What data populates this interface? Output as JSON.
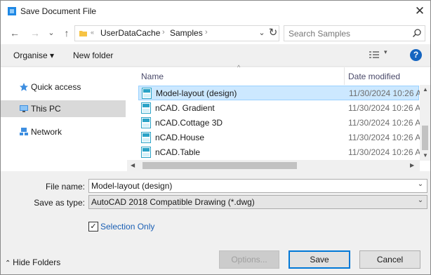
{
  "window": {
    "title": "Save Document File",
    "close_glyph": "✕"
  },
  "nav": {
    "back_glyph": "←",
    "forward_glyph": "→",
    "recent_glyph": "⌄",
    "up_glyph": "↑",
    "breadcrumb": [
      "UserDataCache",
      "Samples"
    ],
    "search_placeholder": "Search Samples"
  },
  "toolbar": {
    "organise": "Organise ▾",
    "new_folder": "New folder",
    "help": "?"
  },
  "sidebar": {
    "items": [
      {
        "label": "Quick access",
        "icon": "star-icon"
      },
      {
        "label": "This PC",
        "icon": "computer-icon",
        "selected": true
      },
      {
        "label": "Network",
        "icon": "network-icon"
      }
    ]
  },
  "file_list": {
    "columns": {
      "name": "Name",
      "date": "Date modified"
    },
    "rows": [
      {
        "name": "Model-layout (design)",
        "date": "11/30/2024 10:26 A",
        "selected": true
      },
      {
        "name": "nCAD. Gradient",
        "date": "11/30/2024 10:26 A"
      },
      {
        "name": "nCAD.Cottage 3D",
        "date": "11/30/2024 10:26 A"
      },
      {
        "name": "nCAD.House",
        "date": "11/30/2024 10:26 A"
      },
      {
        "name": "nCAD.Table",
        "date": "11/30/2024 10:26 A"
      }
    ]
  },
  "form": {
    "file_name_label": "File name:",
    "file_name_value": "Model-layout (design)",
    "save_type_label": "Save as type:",
    "save_type_value": "AutoCAD 2018 Compatible Drawing (*.dwg)",
    "selection_only_label": "Selection Only",
    "selection_only_checked": true
  },
  "footer": {
    "hide_folders": "Hide Folders",
    "options_label": "Options...",
    "save_label": "Save",
    "cancel_label": "Cancel"
  },
  "colors": {
    "selection_bg": "#cce8ff",
    "accent": "#0078d7",
    "link_blue": "#1a5fb4"
  }
}
